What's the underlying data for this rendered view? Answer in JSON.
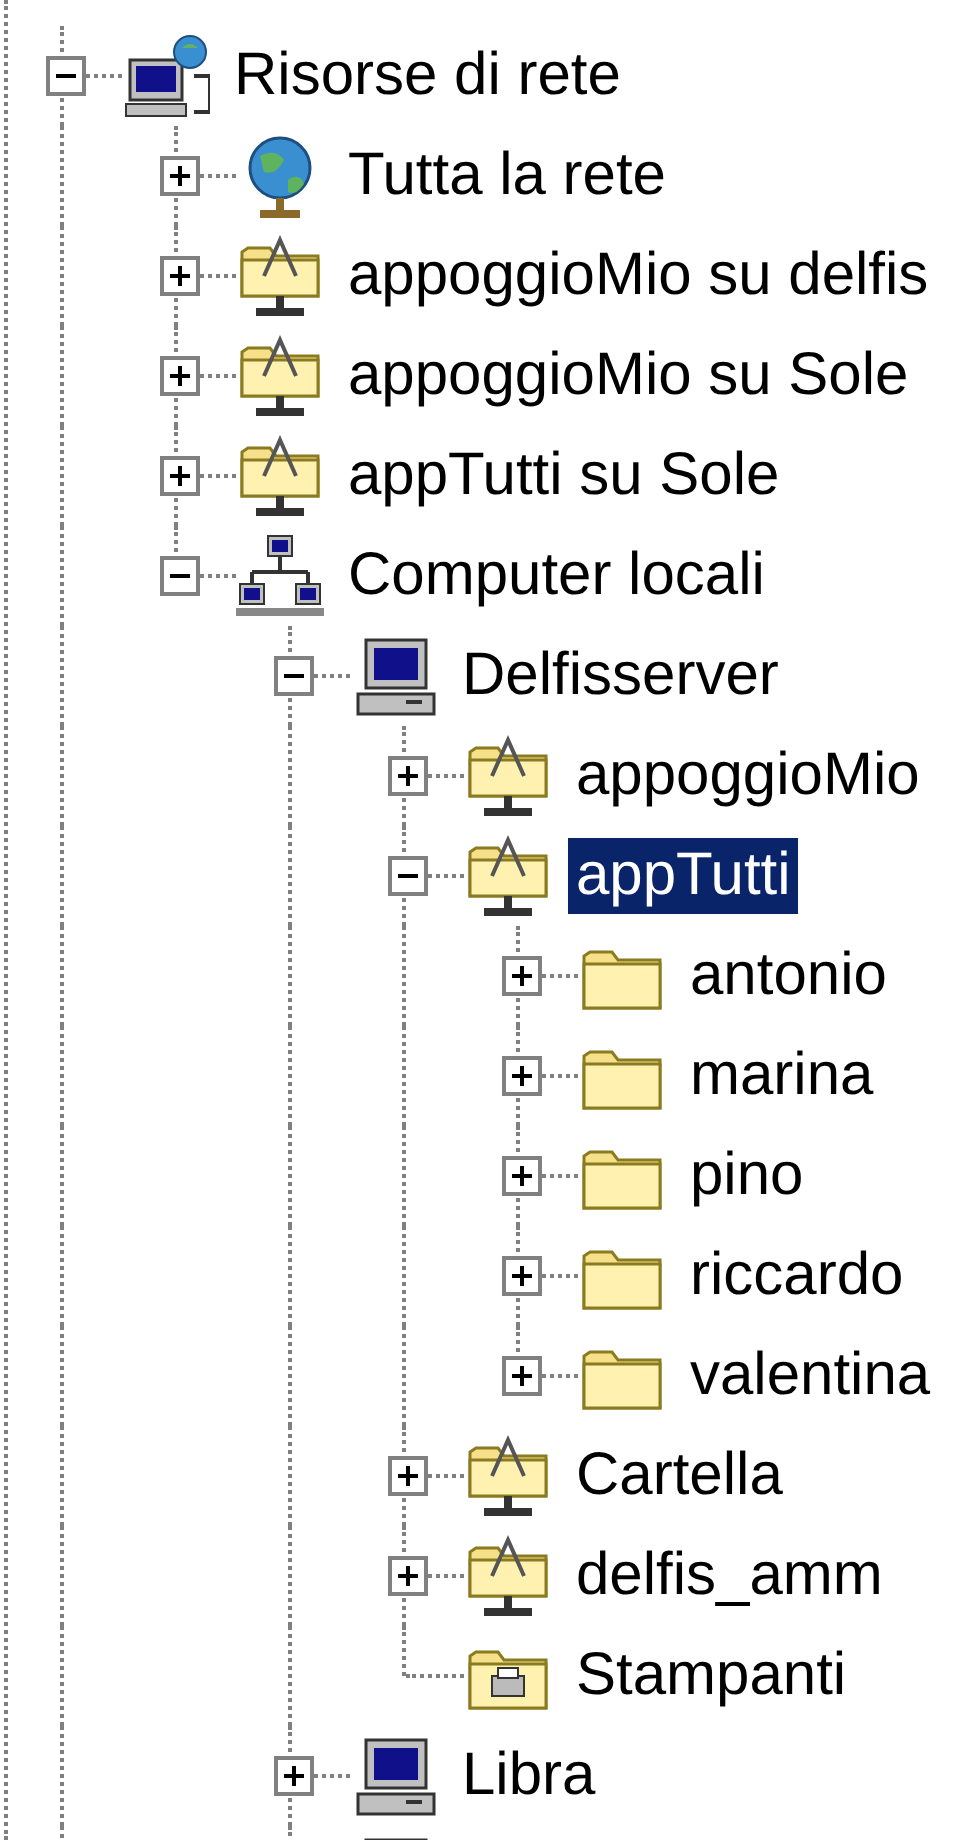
{
  "tree": [
    {
      "label": "Risorse di rete",
      "kind": "network",
      "expandable": true,
      "expanded": true,
      "selected": false,
      "children": [
        {
          "label": "Tutta la rete",
          "kind": "globe",
          "expandable": true,
          "expanded": false,
          "selected": false
        },
        {
          "label": "appoggioMio su delfis",
          "kind": "share",
          "expandable": true,
          "expanded": false,
          "selected": false
        },
        {
          "label": "appoggioMio su Sole",
          "kind": "share",
          "expandable": true,
          "expanded": false,
          "selected": false
        },
        {
          "label": "appTutti su Sole",
          "kind": "share",
          "expandable": true,
          "expanded": false,
          "selected": false
        },
        {
          "label": "Computer locali",
          "kind": "workgroup",
          "expandable": true,
          "expanded": true,
          "selected": false,
          "children": [
            {
              "label": "Delfisserver",
              "kind": "computer",
              "expandable": true,
              "expanded": true,
              "selected": false,
              "children": [
                {
                  "label": "appoggioMio",
                  "kind": "share",
                  "expandable": true,
                  "expanded": false,
                  "selected": false
                },
                {
                  "label": "appTutti",
                  "kind": "share",
                  "expandable": true,
                  "expanded": true,
                  "selected": true,
                  "children": [
                    {
                      "label": "antonio",
                      "kind": "folder",
                      "expandable": true,
                      "expanded": false,
                      "selected": false
                    },
                    {
                      "label": "marina",
                      "kind": "folder",
                      "expandable": true,
                      "expanded": false,
                      "selected": false
                    },
                    {
                      "label": "pino",
                      "kind": "folder",
                      "expandable": true,
                      "expanded": false,
                      "selected": false
                    },
                    {
                      "label": "riccardo",
                      "kind": "folder",
                      "expandable": true,
                      "expanded": false,
                      "selected": false
                    },
                    {
                      "label": "valentina",
                      "kind": "folder",
                      "expandable": true,
                      "expanded": false,
                      "selected": false
                    }
                  ]
                },
                {
                  "label": "Cartella",
                  "kind": "share",
                  "expandable": true,
                  "expanded": false,
                  "selected": false
                },
                {
                  "label": "delfis_amm",
                  "kind": "share",
                  "expandable": true,
                  "expanded": false,
                  "selected": false
                },
                {
                  "label": "Stampanti",
                  "kind": "printers",
                  "expandable": false,
                  "selected": false
                }
              ]
            },
            {
              "label": "Libra",
              "kind": "computer",
              "expandable": true,
              "expanded": false,
              "selected": false
            },
            {
              "kind": "computer"
            }
          ]
        }
      ]
    }
  ]
}
